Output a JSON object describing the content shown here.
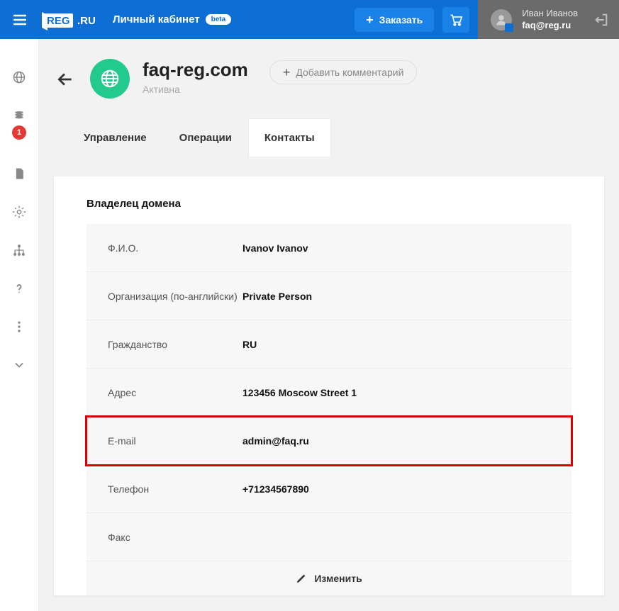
{
  "header": {
    "brand_main": "REG",
    "brand_tld": ".RU",
    "cabinet_label": "Личный кабинет",
    "beta": "beta",
    "order_label": "Заказать",
    "user_name": "Иван Иванов",
    "user_email": "faq@reg.ru"
  },
  "rail": {
    "badge_count": "1"
  },
  "page": {
    "domain_name": "faq-reg.com",
    "domain_status": "Активна",
    "add_comment_label": "Добавить комментарий"
  },
  "tabs": {
    "manage": "Управление",
    "operations": "Операции",
    "contacts": "Контакты"
  },
  "owner": {
    "section_title": "Владелец домена",
    "rows": {
      "fio": {
        "label": "Ф.И.О.",
        "value": "Ivanov Ivanov"
      },
      "org": {
        "label": "Организация (по-английски)",
        "value": "Private Person"
      },
      "citizen": {
        "label": "Гражданство",
        "value": "RU"
      },
      "address": {
        "label": "Адрес",
        "value": "123456 Moscow Street 1"
      },
      "email": {
        "label": "E-mail",
        "value": "admin@faq.ru"
      },
      "phone": {
        "label": "Телефон",
        "value": "+71234567890"
      },
      "fax": {
        "label": "Факс",
        "value": ""
      }
    },
    "edit_label": "Изменить"
  }
}
